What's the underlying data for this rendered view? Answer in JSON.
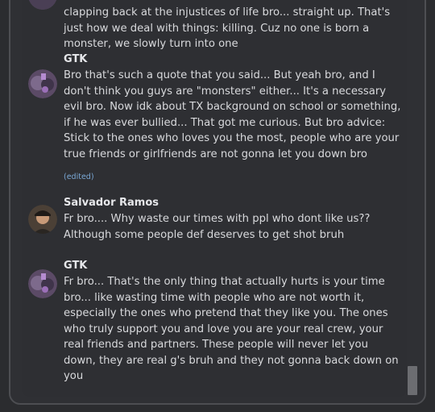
{
  "messages": [
    {
      "author": "",
      "avatar_icon": "avatar-icon",
      "text": "clapping back at the injustices of life bro... straight up. That's just how we deal with things: killing. Cuz no one is born a monster, we slowly turn into one"
    },
    {
      "author": "GTK",
      "avatar_icon": "avatar-icon",
      "text": "Bro that's such a quote that you said... But yeah bro, and I don't think you guys are \"monsters\" either... It's a necessary evil bro. Now idk about TX background on school or something, if he was ever bullied... That got me curious. But bro advice: Stick to the ones who loves you the most, people who are your true friends or girlfriends are not gonna let you down bro",
      "edited": "(edited)"
    },
    {
      "author": "Salvador Ramos",
      "avatar_icon": "avatar-icon",
      "text": "Fr bro.... Why waste our times with ppl who dont like us?? Although some people def deserves to get shot bruh"
    },
    {
      "author": "GTK",
      "avatar_icon": "avatar-icon",
      "text": "Fr bro... That's the only thing that actually hurts is your time bro... like wasting time with people who are not worth it, especially the ones who pretend that they like you. The ones who truly support you and love you are your real crew, your real friends and partners. These people will never let you down, they are real g's bruh and they not gonna back down on you"
    }
  ],
  "colors": {
    "background": "#2b2c2f",
    "panel": "#2e2f33",
    "text": "#d8d9dc",
    "author": "#e6e7ea",
    "edited": "#7aa8d6"
  }
}
